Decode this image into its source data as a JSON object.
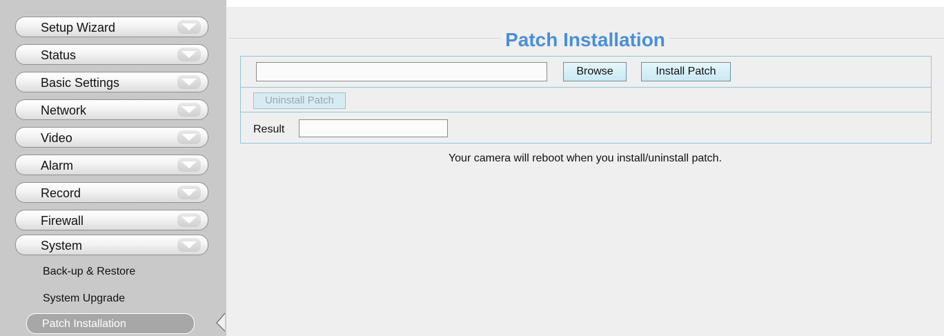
{
  "sidebar": {
    "items": [
      {
        "label": "Setup Wizard"
      },
      {
        "label": "Status"
      },
      {
        "label": "Basic Settings"
      },
      {
        "label": "Network"
      },
      {
        "label": "Video"
      },
      {
        "label": "Alarm"
      },
      {
        "label": "Record"
      },
      {
        "label": "Firewall"
      },
      {
        "label": "System"
      }
    ],
    "system_subitems": [
      {
        "label": "Back-up & Restore"
      },
      {
        "label": "System Upgrade"
      },
      {
        "label": "Patch Installation",
        "active": true
      }
    ],
    "chevron_icon": "chevron-down-icon"
  },
  "main": {
    "title": "Patch Installation",
    "file_input_value": "",
    "browse_label": "Browse",
    "install_label": "Install Patch",
    "uninstall_label": "Uninstall Patch",
    "result_label": "Result",
    "result_value": "",
    "note": "Your camera will reboot when you install/uninstall patch."
  },
  "colors": {
    "title": "#4a8fd6",
    "table_border": "#8fc4dc",
    "button_bg": "#c9e9f3",
    "sidebar_bg": "#c9c9c9",
    "content_bg": "#efefef"
  }
}
